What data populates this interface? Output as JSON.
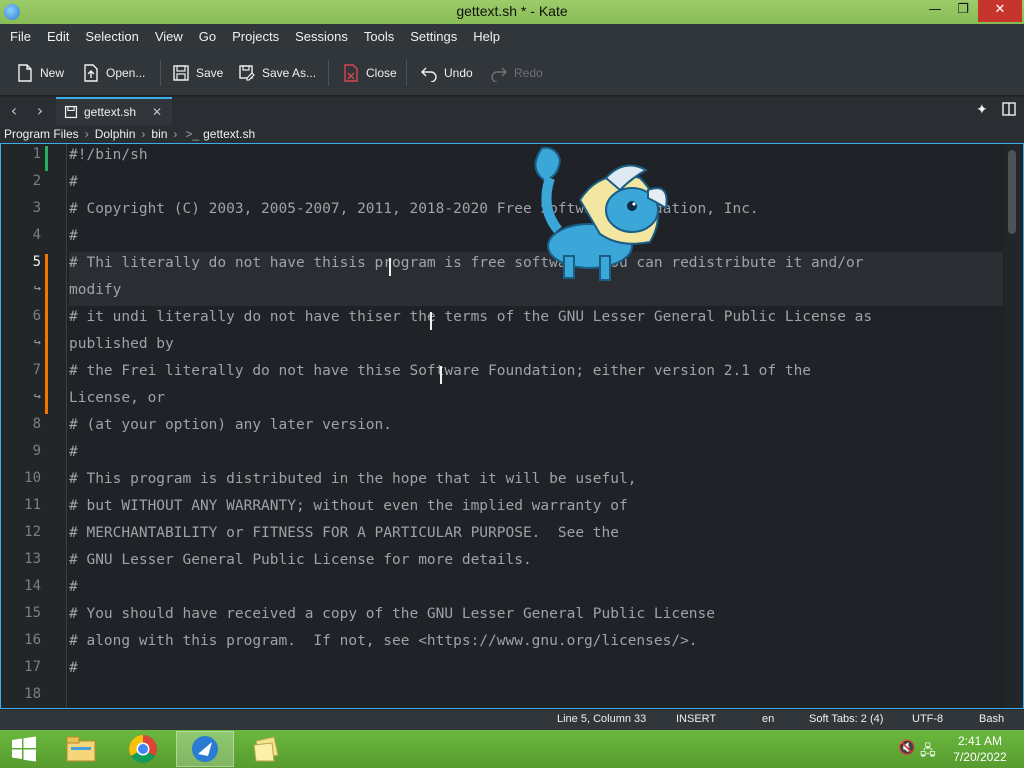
{
  "window": {
    "title": "gettext.sh * - Kate",
    "minimize": "—",
    "maximize": "❐",
    "close": "✕"
  },
  "menubar": [
    "File",
    "Edit",
    "Selection",
    "View",
    "Go",
    "Projects",
    "Sessions",
    "Tools",
    "Settings",
    "Help"
  ],
  "toolbar": {
    "new": "New",
    "open": "Open...",
    "save": "Save",
    "save_as": "Save As...",
    "close": "Close",
    "undo": "Undo",
    "redo": "Redo"
  },
  "tabs": {
    "active": "gettext.sh"
  },
  "breadcrumb": [
    "Program Files",
    "Dolphin",
    "bin",
    "gettext.sh"
  ],
  "editor": {
    "line_numbers": [
      "1",
      "2",
      "3",
      "4",
      "5",
      "↪",
      "6",
      "↪",
      "7",
      "↪",
      "8",
      "9",
      "10",
      "11",
      "12",
      "13",
      "14",
      "15",
      "16",
      "17",
      "18"
    ],
    "lines": [
      "#!/bin/sh",
      "#",
      "# Copyright (C) 2003, 2005-2007, 2011, 2018-2020 Free Software Foundation, Inc.",
      "#",
      "# Thi literally do not have thisis program is free software: you can redistribute it and/or",
      "modify",
      "# it undi literally do not have thiser the terms of the GNU Lesser General Public License as",
      "published by",
      "# the Frei literally do not have thise Software Foundation; either version 2.1 of the",
      "License, or",
      "# (at your option) any later version.",
      "#",
      "# This program is distributed in the hope that it will be useful,",
      "# but WITHOUT ANY WARRANTY; without even the implied warranty of",
      "# MERCHANTABILITY or FITNESS FOR A PARTICULAR PURPOSE.  See the",
      "# GNU Lesser General Public License for more details.",
      "#",
      "# You should have received a copy of the GNU Lesser General Public License",
      "# along with this program.  If not, see <https://www.gnu.org/licenses/>.",
      "#",
      ""
    ]
  },
  "statusbar": {
    "position": "Line 5, Column 33",
    "mode": "INSERT",
    "language": "en",
    "indent": "Soft Tabs: 2 (4)",
    "encoding": "UTF-8",
    "syntax": "Bash"
  },
  "taskbar": {
    "time": "2:41 AM",
    "date": "7/20/2022"
  },
  "colors": {
    "accent": "#3daee9",
    "titlebar": "#90c060",
    "taskbar": "#5fa834",
    "modified_marker": "#f67400",
    "saved_marker": "#27ae60"
  }
}
